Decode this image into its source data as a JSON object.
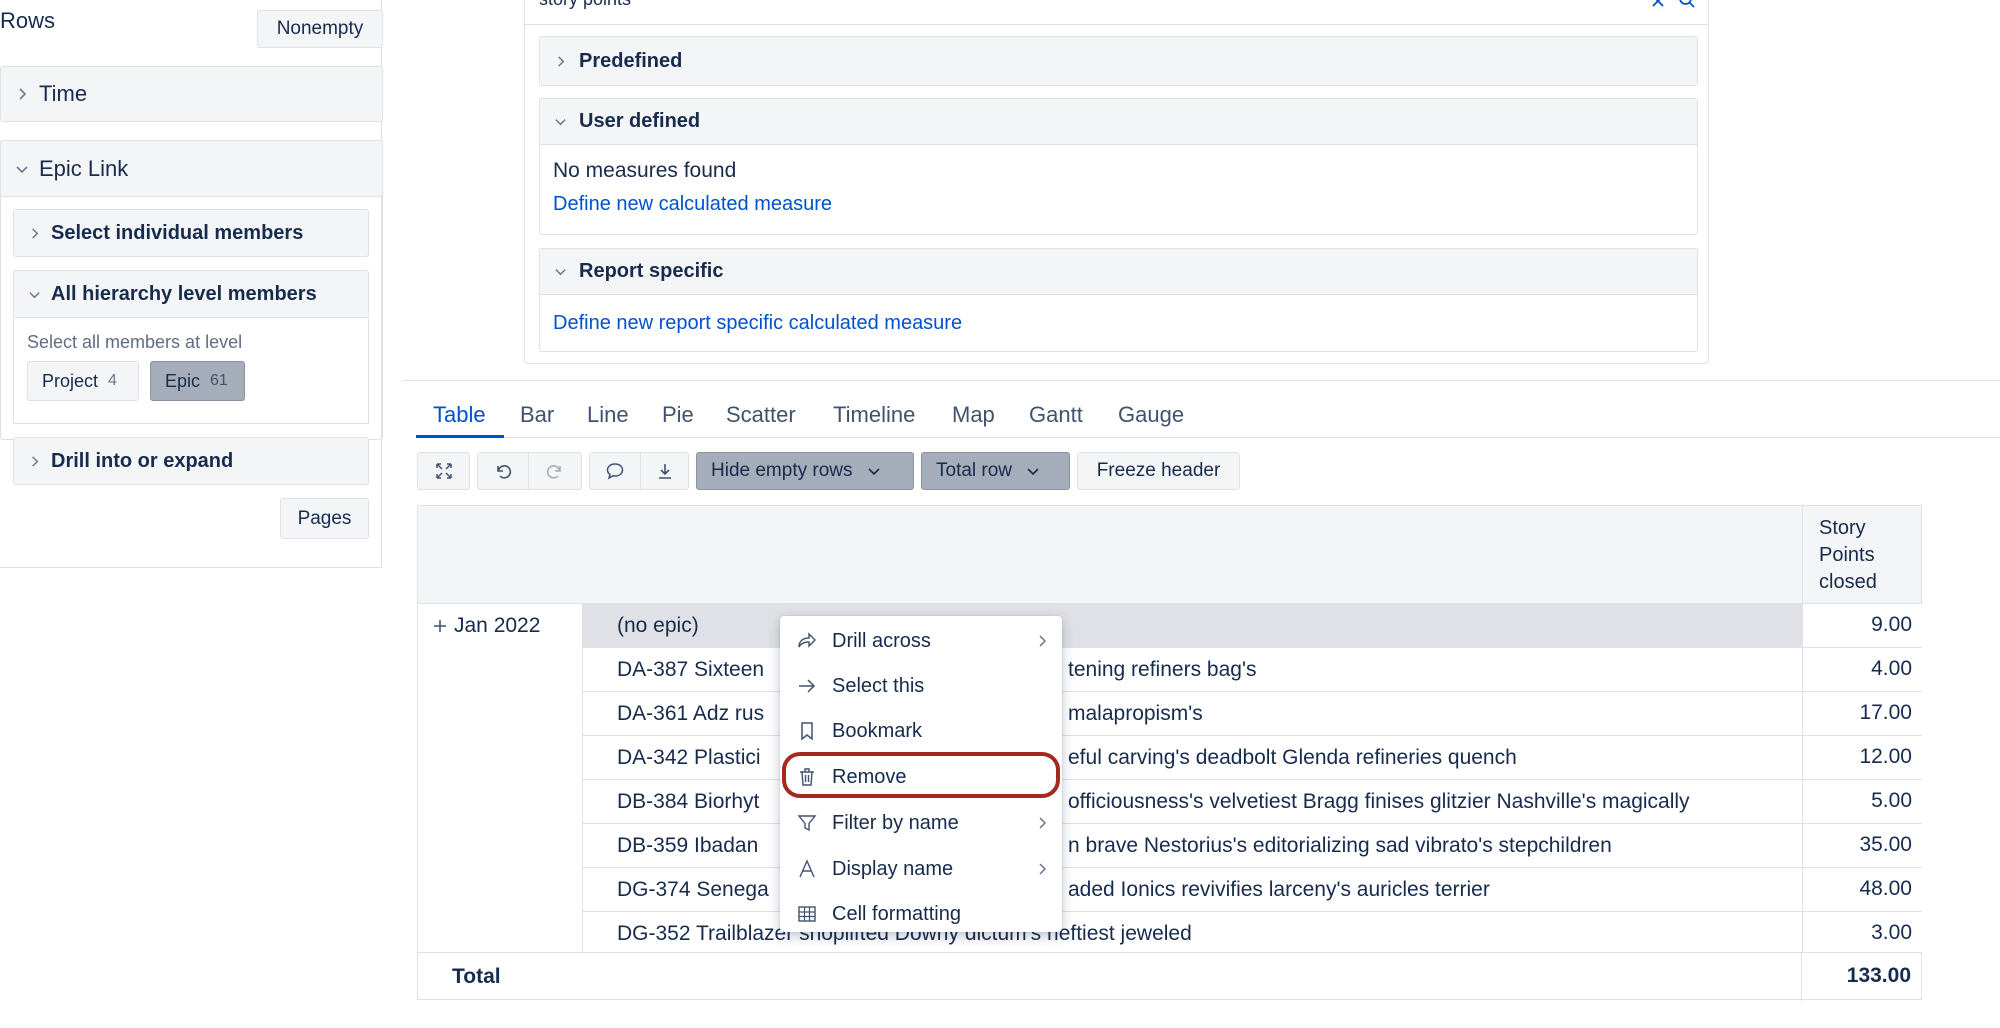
{
  "left_panel": {
    "title": "Rows",
    "nonempty_label": "Nonempty",
    "time_label": "Time",
    "epic_link_label": "Epic Link",
    "select_individual_label": "Select individual members",
    "all_hierarchy_label": "All hierarchy level members",
    "hierarchy_hint": "Select all members at level",
    "chips": [
      {
        "label": "Project",
        "count": "4"
      },
      {
        "label": "Epic",
        "count": "61"
      }
    ],
    "drill_label": "Drill into or expand",
    "pages_label": "Pages"
  },
  "measures": {
    "search_value": "story points",
    "predefined_label": "Predefined",
    "user_defined_label": "User defined",
    "no_measures_text": "No measures found",
    "define_calc_link": "Define new calculated measure",
    "report_specific_label": "Report specific",
    "define_report_link": "Define new report specific calculated measure"
  },
  "tabs": [
    {
      "label": "Table",
      "active": true
    },
    {
      "label": "Bar"
    },
    {
      "label": "Line"
    },
    {
      "label": "Pie"
    },
    {
      "label": "Scatter"
    },
    {
      "label": "Timeline"
    },
    {
      "label": "Map"
    },
    {
      "label": "Gantt"
    },
    {
      "label": "Gauge"
    }
  ],
  "toolbar": {
    "hide_empty_label": "Hide empty rows",
    "total_row_label": "Total row",
    "freeze_label": "Freeze header"
  },
  "table": {
    "measure_header": [
      "Story",
      "Points",
      "closed"
    ],
    "row_group": "Jan 2022",
    "rows": [
      {
        "name": "(no epic)",
        "value": "9.00"
      },
      {
        "name": "DA-387 Sixteen",
        "tail": "tening refiners bag's",
        "value": "4.00"
      },
      {
        "name": "DA-361 Adz rus",
        "tail": "malapropism's",
        "value": "17.00"
      },
      {
        "name": "DA-342 Plastici",
        "tail": "eful carving's deadbolt Glenda refineries quench",
        "value": "12.00"
      },
      {
        "name": "DB-384 Biorhyt",
        "tail": "officiousness's velvetiest Bragg finises glitzier Nashville's magically",
        "value": "5.00"
      },
      {
        "name": "DB-359 Ibadan",
        "tail": "n brave Nestorius's editorializing sad vibrato's stepchildren",
        "value": "35.00"
      },
      {
        "name": "DG-374 Senega",
        "tail": "aded Ionics revivifies larceny's auricles terrier",
        "value": "48.00"
      },
      {
        "name": "DG-352 Trailblazer shoplifted Downy dictum's heftiest jeweled",
        "value": "3.00"
      }
    ],
    "total_label": "Total",
    "total_value": "133.00"
  },
  "context_menu": {
    "items": [
      {
        "label": "Drill across",
        "icon": "drill-across-icon",
        "submenu": true
      },
      {
        "label": "Select this",
        "icon": "arrow-right-icon",
        "submenu": false
      },
      {
        "label": "Bookmark",
        "icon": "bookmark-icon",
        "submenu": false
      },
      {
        "label": "Remove",
        "icon": "trash-icon",
        "submenu": false,
        "highlighted": true
      },
      {
        "label": "Filter by name",
        "icon": "filter-icon",
        "submenu": true
      },
      {
        "label": "Display name",
        "icon": "text-icon",
        "submenu": true
      },
      {
        "label": "Cell formatting",
        "icon": "table-icon",
        "submenu": false
      }
    ]
  },
  "colors": {
    "accent": "#0052cc",
    "highlight_ring": "#a5291f",
    "panel_bg": "#f4f5f7",
    "selected_bg": "#a5adba"
  }
}
